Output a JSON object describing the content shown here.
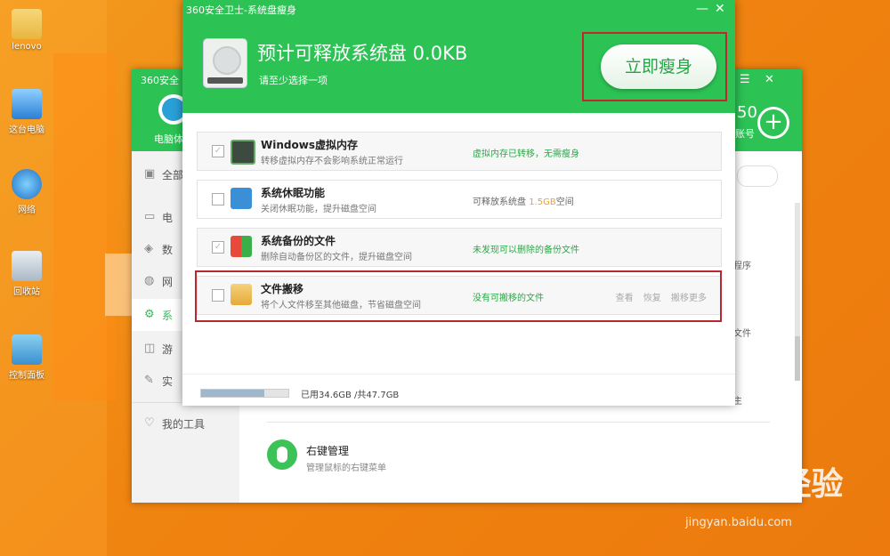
{
  "desktop_icons": [
    {
      "label": "lenovo",
      "icon": "folder-icon"
    },
    {
      "label": "这台电脑",
      "icon": "computer-icon"
    },
    {
      "label": "网络",
      "icon": "network-icon"
    },
    {
      "label": "回收站",
      "icon": "recycle-bin-icon"
    },
    {
      "label": "控制面板",
      "icon": "control-panel-icon"
    }
  ],
  "bg_window": {
    "title": "360安全",
    "tab_partial": "电脑体",
    "account_partial": "账号",
    "number_partial": "50",
    "sidebar": [
      {
        "label": "全部",
        "icon": "gift-icon"
      },
      {
        "label": "电",
        "icon": "monitor-icon"
      },
      {
        "label": "数",
        "icon": "shield-icon"
      },
      {
        "label": "网",
        "icon": "globe-icon"
      },
      {
        "label": "系",
        "icon": "gear-icon"
      },
      {
        "label": "游",
        "icon": "game-icon"
      },
      {
        "label": "实",
        "icon": "tools-icon"
      },
      {
        "label": "我的工具",
        "icon": "heart-icon"
      }
    ],
    "right_partials": [
      "程序",
      "文件",
      "主"
    ],
    "tool": {
      "title": "右键管理",
      "desc": "管理鼠标的右键菜单"
    }
  },
  "dialog": {
    "title": "360安全卫士-系统盘瘦身",
    "headline": "预计可释放系统盘 0.0KB",
    "subtext": "请至少选择一项",
    "action_button": "立即瘦身",
    "rows": [
      {
        "title": "Windows虚拟内存",
        "desc": "转移虚拟内存不会影响系统正常运行",
        "status": "虚拟内存已转移，无需瘦身",
        "checked": true
      },
      {
        "title": "系统休眠功能",
        "desc": "关闭休眠功能，提升磁盘空间",
        "status_prefix": "可释放系统盘",
        "status_value": "1.5GB",
        "status_suffix": "空间",
        "checked": false
      },
      {
        "title": "系统备份的文件",
        "desc": "删除自动备份区的文件，提升磁盘空间",
        "status": "未发现可以删除的备份文件",
        "checked": true
      },
      {
        "title": "文件搬移",
        "desc": "将个人文件移至其他磁盘，节省磁盘空间",
        "status": "没有可搬移的文件",
        "checked": false,
        "actions": [
          "查看",
          "恢复",
          "搬移更多"
        ]
      }
    ],
    "footer": {
      "usage_text": "已用34.6GB /共47.7GB",
      "used_fraction": 0.725
    }
  },
  "watermark": {
    "brand": "Baidu经验",
    "url": "jingyan.baidu.com"
  },
  "colors": {
    "accent": "#2cc254",
    "highlight_box": "#c2272d",
    "status_green": "#2aa847",
    "size_orange": "#f0a030"
  }
}
